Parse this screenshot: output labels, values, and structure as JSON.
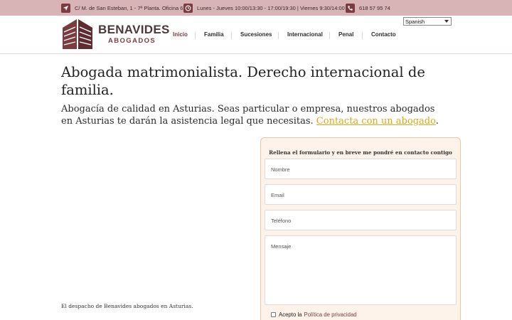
{
  "topbar": {
    "address": "C/ M. de San Esteban, 1 - 7ª Planta. Oficina 6",
    "hours": "Lunes - Jueves 10:00/13:30 - 17:00/19:30 | Viernes 9:30/14:00",
    "phone": "618 57 95 74"
  },
  "header": {
    "logo_title": "BENAVIDES",
    "logo_subtitle": "ABOGADOS",
    "language": "Spanish",
    "nav": [
      "Inicio",
      "Familia",
      "Sucesiones",
      "Internacional",
      "Penal",
      "Contacto"
    ]
  },
  "main": {
    "heading": "Abogada matrimonialista. Derecho internacional de familia.",
    "lead_text": "Abogacía de calidad en Asturias. Seas particular o empresa, nuestros abogados en Asturias te darán la asistencia legal que necesitas. ",
    "lead_link": "Contacta con un abogado",
    "lead_end": ".",
    "caption": "El despacho de Benavides abogados en Asturias."
  },
  "form": {
    "title": "Rellena el formulario y en breve me pondré en contacto contigo",
    "name_placeholder": "Nombre",
    "email_placeholder": "Email",
    "phone_placeholder": "Teléfono",
    "message_placeholder": "Mensaje",
    "consent_text": "Acepto la",
    "consent_link": "Política de privacidad"
  },
  "colors": {
    "brand": "#7a3b41",
    "topbar": "#d9b4b7",
    "link": "#e0a61a",
    "form_bg": "#fdf3ea",
    "form_border": "#f0c79b"
  }
}
